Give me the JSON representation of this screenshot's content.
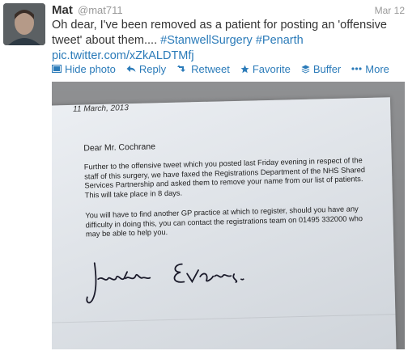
{
  "tweet": {
    "author_name": "Mat",
    "handle": "@mat711",
    "date": "Mar 12",
    "text_plain": "Oh dear, I've been removed as a patient for posting an 'offensive tweet' about them.... ",
    "hashtag_1": "#StanwellSurgery",
    "hashtag_2": "#Penarth",
    "link": "pic.twitter.com/xZkALDTMfj"
  },
  "actions": {
    "hide_photo": "Hide photo",
    "reply": "Reply",
    "retweet": "Retweet",
    "favorite": "Favorite",
    "buffer": "Buffer",
    "more": "More"
  },
  "letter": {
    "date": "11 March, 2013",
    "salutation": "Dear Mr. Cochrane",
    "paragraph_1": "Further to the offensive tweet which you posted last Friday evening in respect of the staff of this surgery, we have faxed the Registrations Department of the NHS Shared Services Partnership and asked them to remove your name from our list of patients. This will take place in 8 days.",
    "paragraph_2": "You will have to find another GP practice at which to register, should you have any difficulty in doing this, you can contact the registrations team on 01495 332000 who may be able to help you.",
    "signature": "Jonathan Evans"
  },
  "colors": {
    "link": "#2b7bb9",
    "muted": "#999999",
    "text": "#333333"
  }
}
